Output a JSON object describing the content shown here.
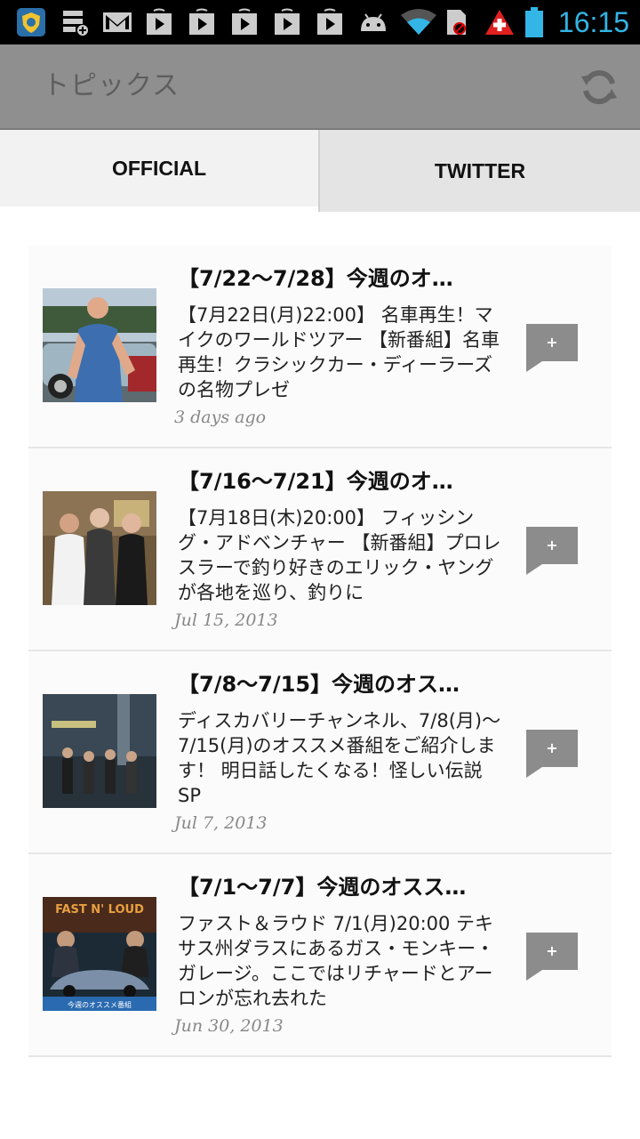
{
  "status_bar": {
    "time": "16:15",
    "icons": [
      "app-shield-icon",
      "storage-add-icon",
      "gmail-icon",
      "play-store-icon",
      "play-store-icon",
      "play-store-icon",
      "play-store-icon",
      "play-store-icon",
      "android-icon",
      "wifi-icon",
      "sim-blocked-icon",
      "swiss-alert-icon",
      "battery-icon"
    ]
  },
  "action_bar": {
    "title": "トピックス",
    "refresh_icon": "refresh-icon"
  },
  "tabs": [
    {
      "label": "OFFICIAL",
      "selected": true
    },
    {
      "label": "TWITTER",
      "selected": false
    }
  ],
  "topics": [
    {
      "title": "【7/22〜7/28】今週のオ…",
      "body": "【7月22日(月)22:00】 名車再生！マイクのワールドツアー 【新番組】名車再生！クラシックカー・ディーラーズの名物プレゼ",
      "date": "3 days ago",
      "action": "+"
    },
    {
      "title": "【7/16〜7/21】今週のオ…",
      "body": "【7月18日(木)20:00】 フィッシング・アドベンチャー 【新番組】プロレスラーで釣り好きのエリック・ヤングが各地を巡り、釣りに",
      "date": "Jul 15, 2013",
      "action": "+"
    },
    {
      "title": "【7/8〜7/15】今週のオス…",
      "body": "ディスカバリーチャンネル、7/8(月)〜7/15(月)のオススメ番組をご紹介します！ 明日話したくなる！怪しい伝説SP",
      "date": "Jul 7, 2013",
      "action": "+"
    },
    {
      "title": "【7/1〜7/7】今週のオスス…",
      "body": "ファスト＆ラウド 7/1(月)20:00 テキサス州ダラスにあるガス・モンキー・ガレージ。ここではリチャードとアーロンが忘れ去れた",
      "date": "Jun 30, 2013",
      "action": "+",
      "thumb_caption": "今週のオススメ番組",
      "thumb_logo": "FAST N' LOUD"
    }
  ]
}
